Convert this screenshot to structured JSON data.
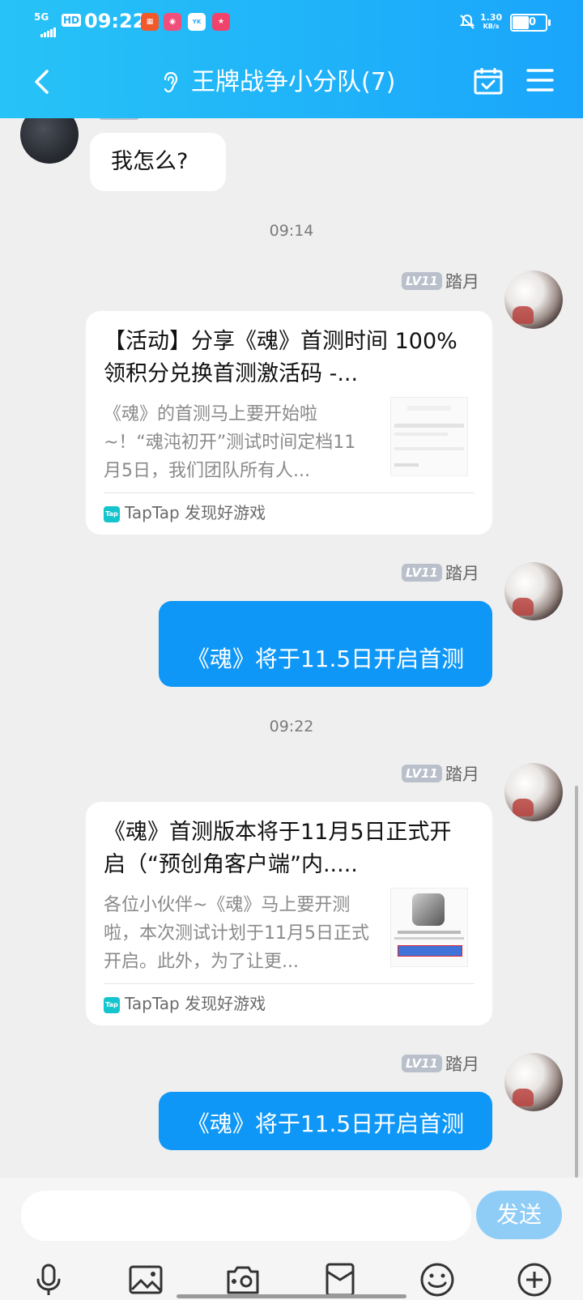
{
  "status_bar": {
    "network": "5G",
    "hd": "HD",
    "time": "09:22",
    "speed_value": "1.30",
    "speed_unit": "KB/s",
    "battery": "50"
  },
  "header": {
    "title": "王牌战争小分队(7)"
  },
  "messages": {
    "m1": {
      "text": "我怎么?"
    },
    "ts1": "09:14",
    "m2": {
      "level": "LV11",
      "sender": "踏月",
      "card_title": "【活动】分享《魂》首测时间 100%领积分兑换首测激活码 -...",
      "card_desc": "《魂》的首测马上要开始啦~！“魂沌初开”测试时间定档11月5日，我们团队所有人...",
      "card_source": "TapTap 发现好游戏"
    },
    "m3": {
      "level": "LV11",
      "sender": "踏月",
      "text": "《魂》将于11.5日开启首测"
    },
    "ts2": "09:22",
    "m4": {
      "level": "LV11",
      "sender": "踏月",
      "card_title": "《魂》首测版本将于11月5日正式开启（“预创角客户端”内.....",
      "card_desc": "各位小伙伴~《魂》马上要开测啦，本次测试计划于11月5日正式开启。此外，为了让更...",
      "card_source": "TapTap 发现好游戏"
    },
    "m5": {
      "level": "LV11",
      "sender": "踏月",
      "text": "《魂》将于11.5日开启首测"
    }
  },
  "input": {
    "send_label": "发送"
  },
  "toolbar_icons": [
    "microphone-icon",
    "image-icon",
    "camera-icon",
    "red-packet-icon",
    "emoji-icon",
    "plus-icon"
  ]
}
